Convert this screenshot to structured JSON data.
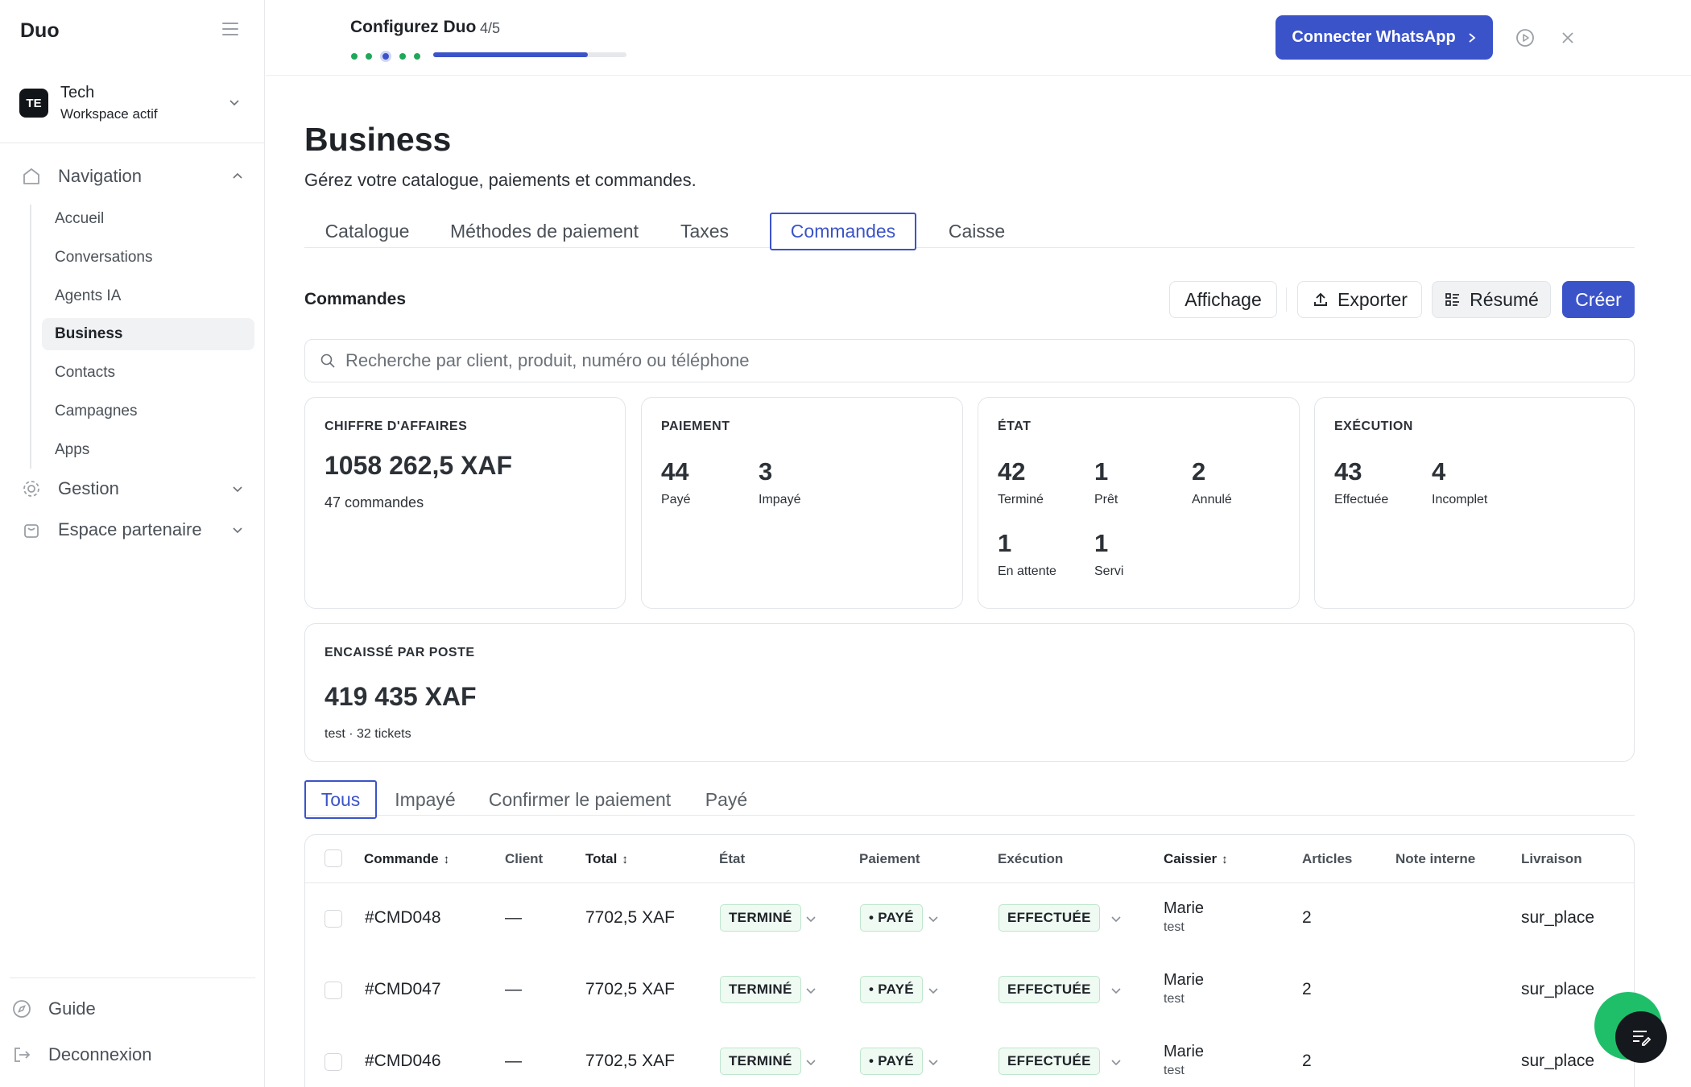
{
  "sidebar": {
    "brand": "Duo",
    "workspace": {
      "initials": "TE",
      "name": "Tech",
      "status": "Workspace actif"
    },
    "groups": {
      "navigation": "Navigation",
      "gestion": "Gestion",
      "partner": "Espace partenaire"
    },
    "items": [
      {
        "label": "Accueil"
      },
      {
        "label": "Conversations"
      },
      {
        "label": "Agents IA"
      },
      {
        "label": "Business"
      },
      {
        "label": "Contacts"
      },
      {
        "label": "Campagnes"
      },
      {
        "label": "Apps"
      }
    ],
    "footer": {
      "guide": "Guide",
      "logout": "Deconnexion"
    }
  },
  "topbar": {
    "setup_title": "Configurez Duo",
    "setup_count": "4/5",
    "progress": 0.8,
    "whatsapp_button": "Connecter WhatsApp"
  },
  "page": {
    "title": "Business",
    "subtitle": "Gérez votre catalogue, paiements et commandes.",
    "tabs": [
      {
        "label": "Catalogue"
      },
      {
        "label": "Méthodes de paiement"
      },
      {
        "label": "Taxes"
      },
      {
        "label": "Commandes"
      },
      {
        "label": "Caisse"
      }
    ],
    "section_title": "Commandes",
    "actions": {
      "display": "Affichage",
      "export": "Exporter",
      "summary": "Résumé",
      "create": "Créer"
    },
    "search_placeholder": "Recherche par client, produit, numéro ou téléphone"
  },
  "cards": {
    "revenue": {
      "title": "CHIFFRE D'AFFAIRES",
      "value": "1058 262,5 XAF",
      "sub": "47 commandes"
    },
    "payment": {
      "title": "PAIEMENT",
      "stats": [
        {
          "value": "44",
          "label": "Payé"
        },
        {
          "value": "3",
          "label": "Impayé"
        }
      ]
    },
    "state": {
      "title": "ÉTAT",
      "stats": [
        {
          "value": "42",
          "label": "Terminé"
        },
        {
          "value": "1",
          "label": "Prêt"
        },
        {
          "value": "2",
          "label": "Annulé"
        },
        {
          "value": "1",
          "label": "En attente"
        },
        {
          "value": "1",
          "label": "Servi"
        }
      ]
    },
    "execution": {
      "title": "EXÉCUTION",
      "stats": [
        {
          "value": "43",
          "label": "Effectuée"
        },
        {
          "value": "4",
          "label": "Incomplet"
        }
      ]
    },
    "station": {
      "title": "ENCAISSÉ PAR POSTE",
      "value": "419 435 XAF",
      "sub": "test · 32 tickets"
    }
  },
  "subtabs": [
    {
      "label": "Tous"
    },
    {
      "label": "Impayé"
    },
    {
      "label": "Confirmer le paiement"
    },
    {
      "label": "Payé"
    }
  ],
  "table": {
    "columns": {
      "order": "Commande",
      "client": "Client",
      "total": "Total",
      "state": "État",
      "payment": "Paiement",
      "execution": "Exécution",
      "cashier": "Caissier",
      "items": "Articles",
      "note": "Note interne",
      "delivery": "Livraison"
    },
    "sort_glyph": "↕",
    "rows": [
      {
        "id": "#CMD048",
        "client": "—",
        "total": "7702,5 XAF",
        "state": "TERMINÉ",
        "payment": "• PAYÉ",
        "execution": "EFFECTUÉE",
        "cashier": "Marie",
        "cashier_sub": "test",
        "items": "2",
        "delivery": "sur_place"
      },
      {
        "id": "#CMD047",
        "client": "—",
        "total": "7702,5 XAF",
        "state": "TERMINÉ",
        "payment": "• PAYÉ",
        "execution": "EFFECTUÉE",
        "cashier": "Marie",
        "cashier_sub": "test",
        "items": "2",
        "delivery": "sur_place"
      },
      {
        "id": "#CMD046",
        "client": "—",
        "total": "7702,5 XAF",
        "state": "TERMINÉ",
        "payment": "• PAYÉ",
        "execution": "EFFECTUÉE",
        "cashier": "Marie",
        "cashier_sub": "test",
        "items": "2",
        "delivery": "sur_place"
      }
    ]
  },
  "colors": {
    "accent": "#3b53c9",
    "success": "#1fa85a",
    "pill_bg": "#eefaf2"
  }
}
